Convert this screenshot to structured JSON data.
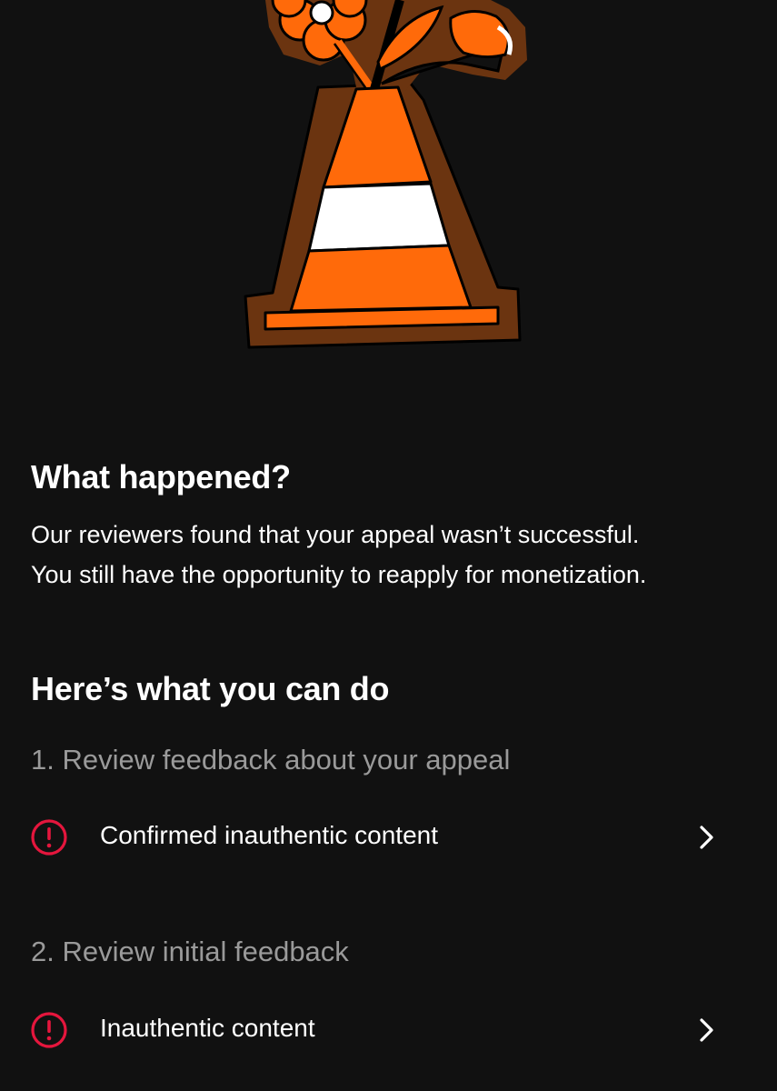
{
  "colors": {
    "background": "#111111",
    "text_primary": "#ffffff",
    "text_secondary": "#9a9a9a",
    "alert": "#e5163d",
    "cone_orange": "#ff6a0a",
    "cone_outline_brown": "#6b3410",
    "cone_stripe": "#ffffff"
  },
  "illustration": {
    "icon": "traffic-cone-with-flowers-illustration"
  },
  "what_happened": {
    "title": "What happened?",
    "body_line_1": "Our reviewers found that your appeal wasn’t successful.",
    "body_line_2": "You still have the opportunity to reapply for monetization."
  },
  "what_to_do": {
    "title": "Here’s what you can do",
    "steps": [
      {
        "heading": "1. Review feedback about your appeal",
        "item": {
          "icon": "alert-circle-icon",
          "label": "Confirmed inauthentic content",
          "action_icon": "chevron-right-icon"
        }
      },
      {
        "heading": "2. Review initial feedback",
        "item": {
          "icon": "alert-circle-icon",
          "label": "Inauthentic content",
          "action_icon": "chevron-right-icon"
        }
      }
    ]
  }
}
